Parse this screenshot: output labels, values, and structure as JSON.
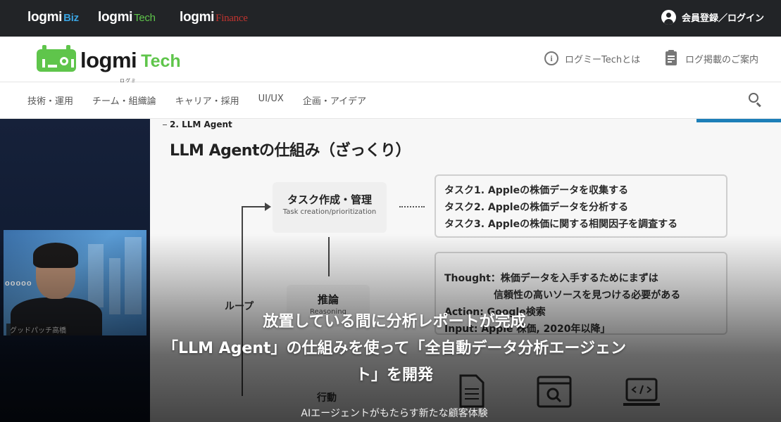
{
  "topbar": {
    "logos": [
      {
        "name": "logmi",
        "sub": "Biz"
      },
      {
        "name": "logmi",
        "sub": "Tech"
      },
      {
        "name": "logmi",
        "sub": "Finance"
      }
    ],
    "login_label": "会員登録／ログイン",
    "login_icon": "account-circle-icon"
  },
  "header": {
    "brand_name": "logmi",
    "brand_kana": "ログミー",
    "brand_suffix": "Tech",
    "about_label": "ログミーTechとは",
    "about_icon": "info-icon",
    "guide_label": "ログ掲載のご案内",
    "guide_icon": "clipboard-icon"
  },
  "nav": {
    "items": [
      "技術・運用",
      "チーム・組織論",
      "キャリア・採用",
      "UI/UX",
      "企画・アイデア"
    ],
    "search_icon": "search-icon"
  },
  "hero": {
    "slide": {
      "section": "2. LLM Agent",
      "title": "LLM Agentの仕組み（ざっくり）",
      "node_task_jp": "タスク作成・管理",
      "node_task_en": "Task creation/prioritization",
      "node_reason_jp": "推論",
      "node_reason_en": "Reasoning",
      "loop_label": "ループ",
      "action_label": "行動",
      "tasks": [
        "タスク1. Appleの株価データを収集する",
        "タスク2. Appleの株価データを分析する",
        "タスク3. Appleの株価に関する相関因子を調査する"
      ],
      "reasoning_lines": [
        "Thought：株価データを入手するためにまずは",
        "　　　　　信頼性の高いソースを見つける必要がある",
        "Action: Google検索",
        "Input: Apple 株価, 2020年以降」"
      ]
    },
    "cam_name": "グッドパッチ高橋",
    "cam_logo": "ooooo",
    "caption_line1": "放置している間に分析レポートが完成",
    "caption_line2": "「LLM Agent」の仕組みを使って「全自動データ分析エージェン",
    "caption_line3": "ト」を開発",
    "subcaption": "AIエージェントがもたらす新たな顧客体験"
  },
  "colors": {
    "brand_green": "#5fc54b",
    "biz_blue": "#3aa3e0",
    "finance_red": "#c0342f",
    "topbar_bg": "#222427"
  }
}
